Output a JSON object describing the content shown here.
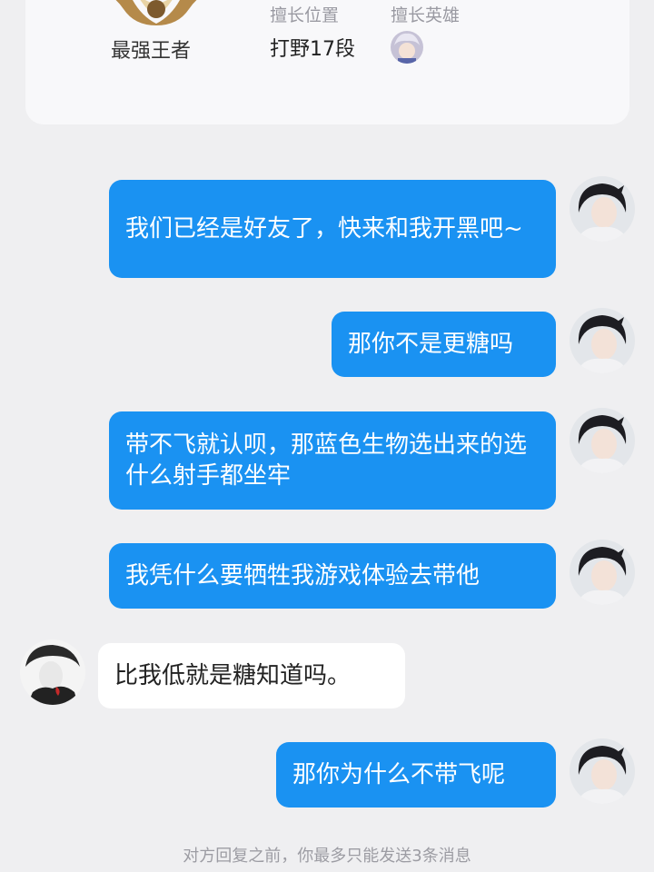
{
  "profile": {
    "rank_label": "最强王者",
    "position_header": "擅长位置",
    "hero_header": "擅长英雄",
    "position_value": "打野17段"
  },
  "messages": [
    {
      "direction": "sent",
      "text": "我们已经是好友了，快来和我开黑吧~"
    },
    {
      "direction": "sent",
      "text": "那你不是更糖吗"
    },
    {
      "direction": "sent",
      "text": "带不飞就认呗，那蓝色生物选出来的选什么射手都坐牢"
    },
    {
      "direction": "sent",
      "text": "我凭什么要牺牲我游戏体验去带他"
    },
    {
      "direction": "received",
      "text": "比我低就是糖知道吗。"
    },
    {
      "direction": "sent",
      "text": "那你为什么不带飞呢"
    }
  ],
  "footer": {
    "note": "对方回复之前，你最多只能发送3条消息"
  },
  "colors": {
    "sent_bubble": "#1a92f2",
    "received_bubble": "#ffffff",
    "background": "#efeff1"
  },
  "icons": {
    "rank": "king-rank-emblem-icon",
    "hero": "hero-avatar-icon",
    "self_avatar": "self-avatar",
    "other_avatar": "other-avatar"
  }
}
